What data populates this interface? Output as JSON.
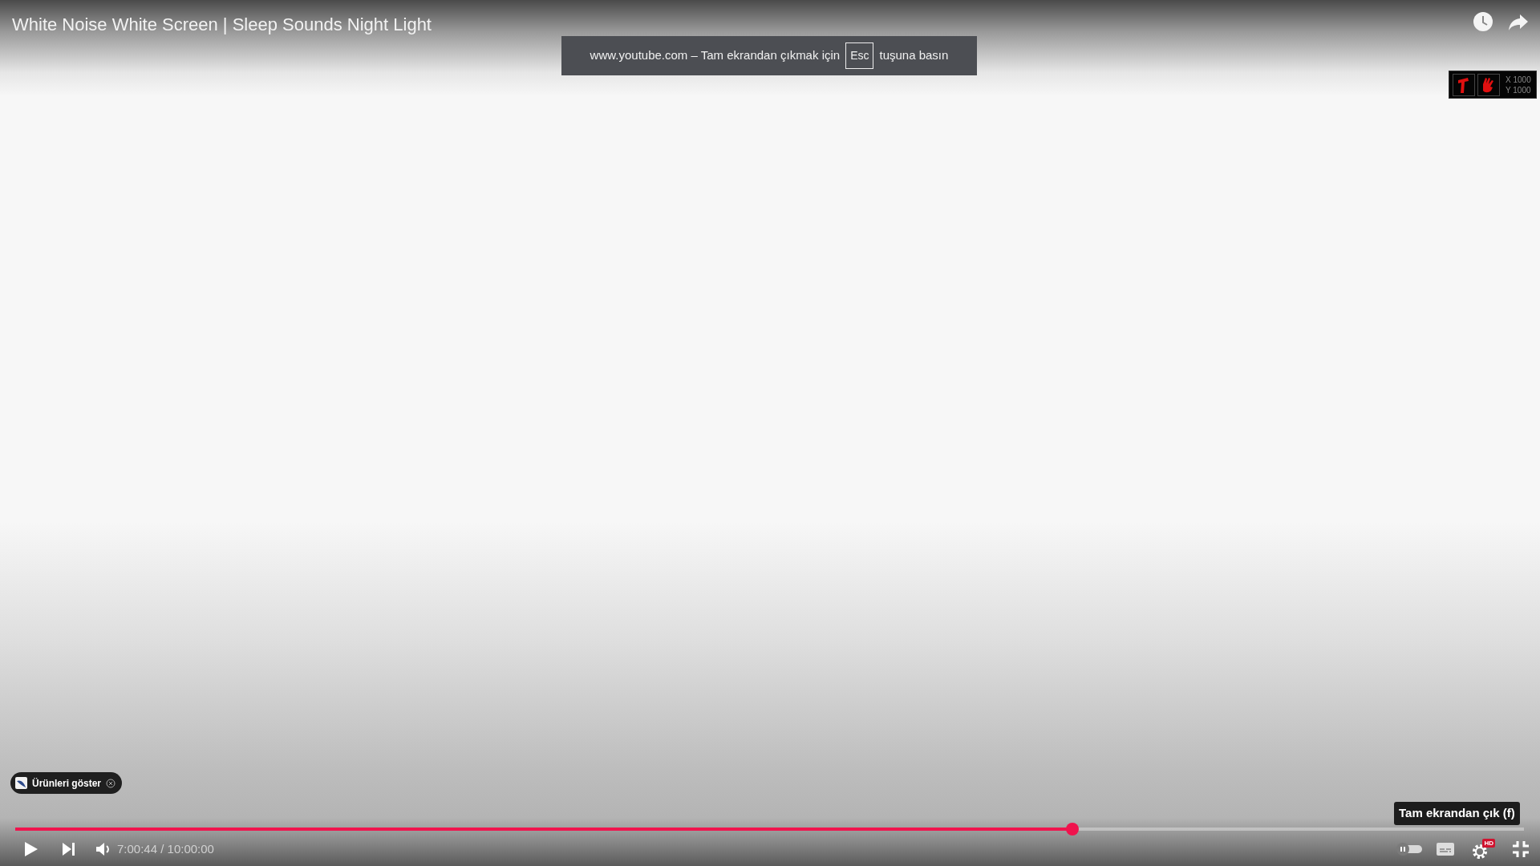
{
  "video_title": "White Noise White Screen | Sleep Sounds Night Light",
  "fullscreen_notice": {
    "text_before": "www.youtube.com – Tam ekrandan çıkmak için",
    "key": "Esc",
    "text_after": "tuşuna basın"
  },
  "mouse_overlay": {
    "x": "X 1000",
    "y": "Y 1000"
  },
  "products_chip": {
    "label": "Ürünleri göster"
  },
  "tooltip": "Tam ekrandan çık (f)",
  "progress": {
    "level": 0.7007
  },
  "time": "7:00:44 / 10:00:00",
  "autoplay": {
    "on": false
  },
  "quality_badge": "HD"
}
